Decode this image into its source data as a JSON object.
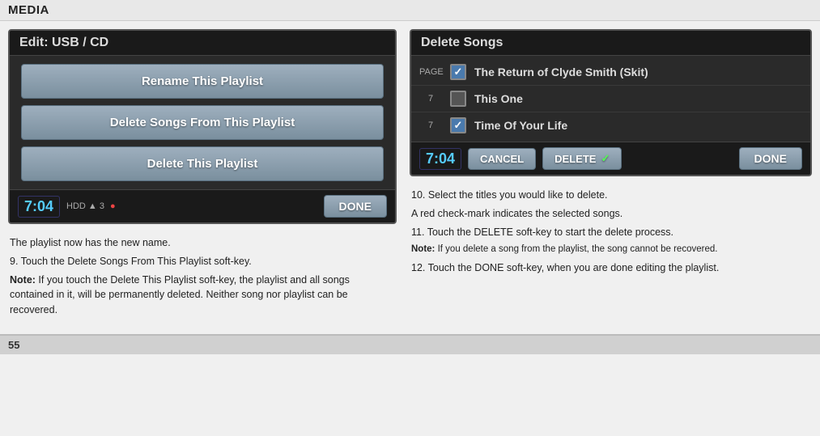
{
  "page": {
    "title": "MEDIA",
    "page_number": "55"
  },
  "left_screen": {
    "header": "Edit: USB / CD",
    "buttons": [
      {
        "label": "Rename This Playlist"
      },
      {
        "label": "Delete Songs From This Playlist"
      },
      {
        "label": "Delete This Playlist"
      }
    ],
    "footer": {
      "time": "7:04",
      "hdd_label": "HDD",
      "hdd_arrow": "▲",
      "hdd_number": "3",
      "done_label": "DONE"
    }
  },
  "left_text": {
    "line1": "The playlist now has the new name.",
    "line2": "9. Touch the Delete Songs From This Playlist soft-key.",
    "note_label": "Note:",
    "note_body": " If you touch the Delete This Playlist soft-key, the playlist and all songs contained in it, will be permanently deleted. Neither  song nor playlist can be recovered."
  },
  "right_screen": {
    "header": "Delete Songs",
    "songs": [
      {
        "page_label": "PAGE",
        "checked": true,
        "title": "The Return of Clyde Smith (Skit)"
      },
      {
        "page_label": "7",
        "checked": false,
        "title": "This One"
      },
      {
        "page_label": "7",
        "checked": true,
        "title": "Time Of Your Life"
      }
    ],
    "footer": {
      "time": "7:04",
      "cancel_label": "CANCEL",
      "delete_label": "DELETE",
      "done_label": "DONE"
    }
  },
  "right_text": {
    "line1": "10. Select the titles you would like to delete.",
    "line2": "A red check-mark indicates the selected songs.",
    "line3": "11. Touch the DELETE soft-key to start the delete process.",
    "note_label": "Note:",
    "note_body": " If you delete a song from the playlist, the song cannot be recovered.",
    "line4": "12.  Touch  the  DONE  soft-key,  when  you  are  done  editing  the playlist."
  }
}
